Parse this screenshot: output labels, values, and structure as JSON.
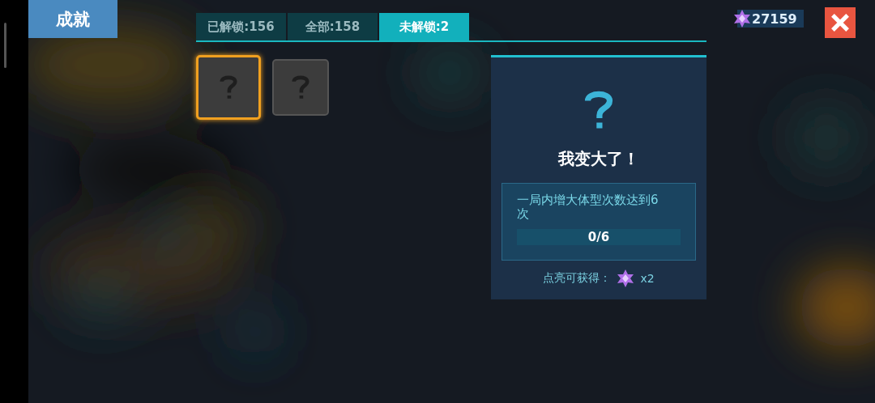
{
  "title": "成就",
  "tabs": [
    {
      "label": "已解锁:156",
      "selected": false
    },
    {
      "label": "全部:158",
      "selected": false
    },
    {
      "label": "未解锁:2",
      "selected": true
    }
  ],
  "achievements": [
    {
      "selected": true
    },
    {
      "selected": false
    }
  ],
  "currency": "27159",
  "detail": {
    "title": "我变大了！",
    "description": "一局内增大体型次数达到6次",
    "progress": {
      "text": "0/6"
    },
    "reward": {
      "label": "点亮可获得：",
      "amount": "x2"
    }
  }
}
